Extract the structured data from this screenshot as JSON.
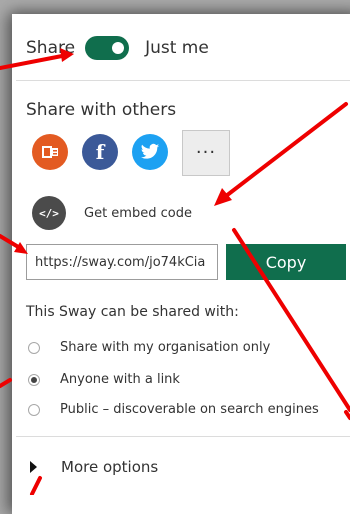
{
  "share": {
    "label": "Share",
    "value": "Just me",
    "enabled": true
  },
  "share_with_others": {
    "title": "Share with others",
    "buttons": [
      {
        "name": "office-icon"
      },
      {
        "name": "facebook-icon",
        "glyph": "f"
      },
      {
        "name": "twitter-icon"
      },
      {
        "name": "more-icon",
        "glyph": "···"
      }
    ]
  },
  "embed": {
    "glyph": "</>",
    "label": "Get embed code"
  },
  "link": {
    "value": "https://sway.com/jo74kCia",
    "copy_label": "Copy"
  },
  "permissions": {
    "title": "This Sway can be shared with:",
    "options": [
      {
        "label": "Share with my organisation only",
        "selected": false
      },
      {
        "label": "Anyone with a link",
        "selected": true
      },
      {
        "label": "Public – discoverable on search engines",
        "selected": false
      }
    ]
  },
  "more_options": {
    "label": "More options"
  },
  "colors": {
    "accent": "#106e4d",
    "annotation": "#ee0000",
    "office": "#e35b22",
    "facebook": "#3b5998",
    "twitter": "#1da1f2"
  }
}
